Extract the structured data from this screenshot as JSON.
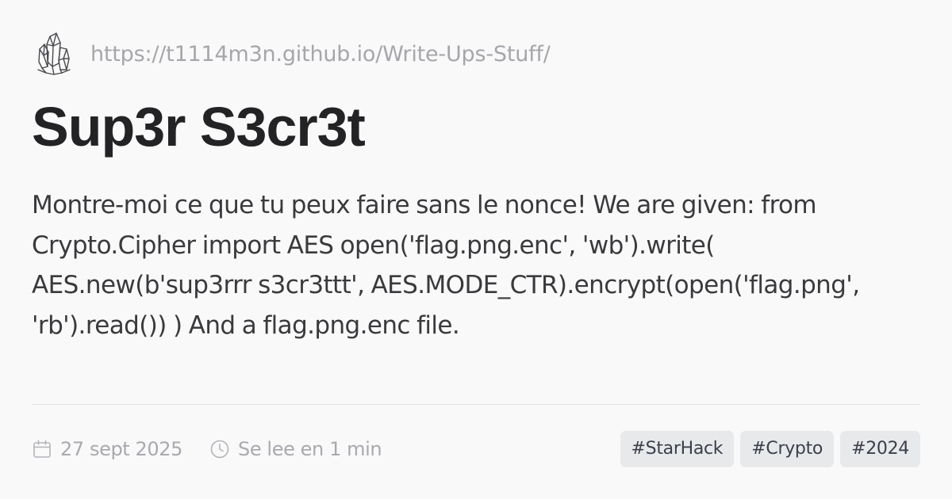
{
  "site": {
    "logo_icon": "crystal-cluster-icon",
    "url": "https://t1114m3n.github.io/Write-Ups-Stuff/"
  },
  "post": {
    "title": "Sup3r S3cr3t",
    "description": "Montre-moi ce que tu peux faire sans le nonce! We are given: from Crypto.Cipher import AES open('flag.png.enc', 'wb').write( AES.new(b'sup3rrr s3cr3ttt', AES.MODE_CTR).encrypt(open('flag.png', 'rb').read()) ) And a flag.png.enc file."
  },
  "meta": {
    "date_icon": "calendar-icon",
    "date": "27 sept 2025",
    "reading_icon": "clock-icon",
    "reading_time": "Se lee en 1 min"
  },
  "tags": [
    {
      "label": "#StarHack"
    },
    {
      "label": "#Crypto"
    },
    {
      "label": "#2024"
    }
  ]
}
